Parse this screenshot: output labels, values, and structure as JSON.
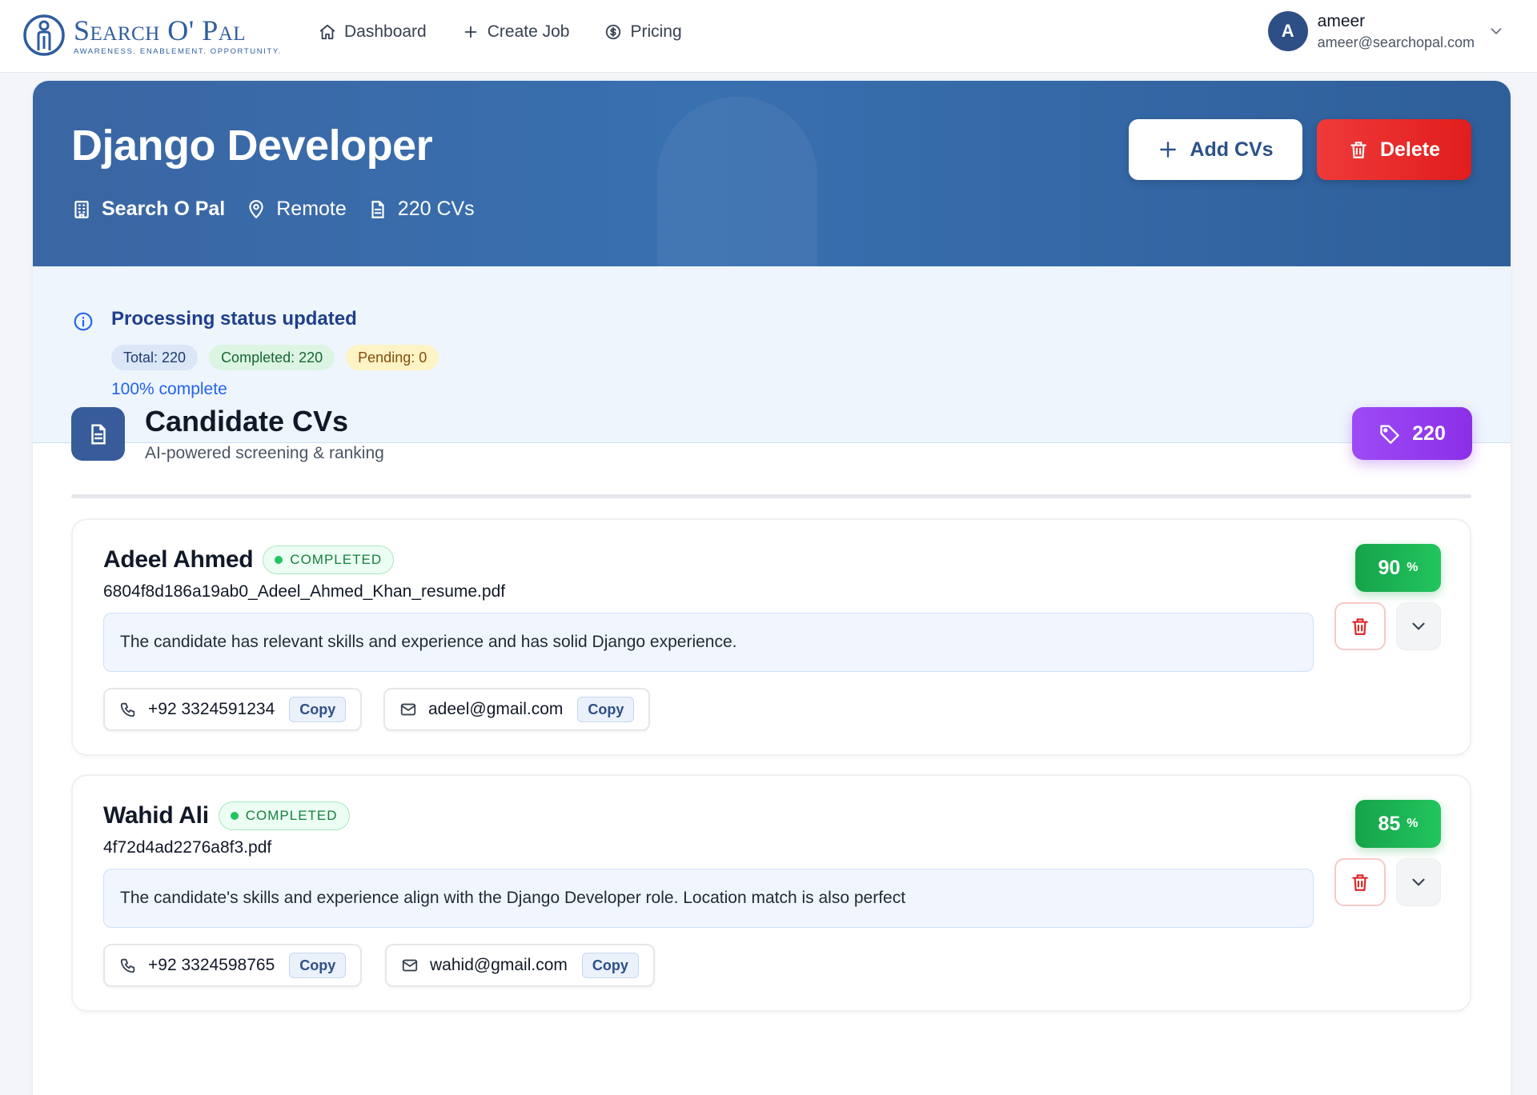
{
  "nav": {
    "logo_title": "Search O' Pal",
    "logo_tagline": "AWARENESS. ENABLEMENT. OPPORTUNITY.",
    "links": [
      {
        "label": "Dashboard",
        "icon": "home-icon"
      },
      {
        "label": "Create Job",
        "icon": "plus-icon"
      },
      {
        "label": "Pricing",
        "icon": "dollar-circle-icon"
      }
    ],
    "user": {
      "initial": "A",
      "name": "ameer",
      "email": "ameer@searchopal.com"
    }
  },
  "job": {
    "title": "Django Developer",
    "company": "Search O Pal",
    "location": "Remote",
    "cv_count": "220 CVs",
    "add_label": "Add CVs",
    "delete_label": "Delete"
  },
  "status": {
    "title": "Processing status updated",
    "total": "Total: 220",
    "completed": "Completed: 220",
    "pending": "Pending: 0",
    "progress_text": "100% complete",
    "progress_fraction": 1.0
  },
  "candidates_section": {
    "title": "Candidate CVs",
    "subtitle": "AI-powered screening & ranking",
    "count": "220"
  },
  "candidates": [
    {
      "name": "Adeel Ahmed",
      "status": "COMPLETED",
      "file": "6804f8d186a19ab0_Adeel_Ahmed_Khan_resume.pdf",
      "summary": "The candidate has relevant skills and experience and has solid Django experience.",
      "phone": "+92 3324591234",
      "email": "adeel@gmail.com",
      "score": "90",
      "score_unit": "%",
      "copy_label": "Copy"
    },
    {
      "name": "Wahid Ali",
      "status": "COMPLETED",
      "file": "4f72d4ad2276a8f3.pdf",
      "summary": "The candidate's skills and experience align with the Django Developer role. Location match is also perfect",
      "phone": "+92 3324598765",
      "email": "wahid@gmail.com",
      "score": "85",
      "score_unit": "%",
      "copy_label": "Copy"
    }
  ],
  "colors": {
    "brand": "#2f5d9e",
    "hero": "#3970b0",
    "danger": "#e11d1d",
    "success": "#22c55e",
    "accent_purple": "#8b2fe8"
  }
}
